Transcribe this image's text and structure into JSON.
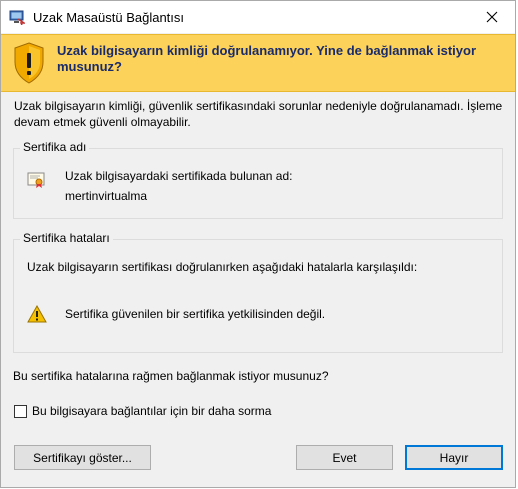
{
  "window": {
    "title": "Uzak Masaüstü Bağlantısı"
  },
  "banner": {
    "message": "Uzak bilgisayarın kimliği doğrulanamıyor. Yine de bağlanmak istiyor musunuz?"
  },
  "description": "Uzak bilgisayarın kimliği, güvenlik sertifikasındaki sorunlar nedeniyle doğrulanamadı. İşleme devam etmek güvenli olmayabilir.",
  "certificate_name": {
    "legend": "Sertifika adı",
    "label": "Uzak bilgisayardaki sertifikada bulunan ad:",
    "value": "mertinvirtualma"
  },
  "certificate_errors": {
    "legend": "Sertifika hataları",
    "intro": "Uzak bilgisayarın sertifikası doğrulanırken aşağıdaki hatalarla karşılaşıldı:",
    "errors": [
      "Sertifika güvenilen bir sertifika yetkilisinden değil."
    ]
  },
  "question": "Bu sertifika hatalarına rağmen bağlanmak istiyor musunuz?",
  "dont_ask_checkbox": {
    "label": "Bu bilgisayara bağlantılar için bir daha sorma",
    "checked": false
  },
  "buttons": {
    "show_certificate": "Sertifikayı göster...",
    "yes": "Evet",
    "no": "Hayır"
  },
  "colors": {
    "banner_bg": "#fcd25a",
    "banner_text": "#1a2b6b",
    "default_button_border": "#0078d7"
  },
  "icons": {
    "app": "remote-desktop-icon",
    "banner": "warning-shield-icon",
    "certificate": "certificate-icon",
    "error": "warning-triangle-icon",
    "close": "close-icon"
  }
}
